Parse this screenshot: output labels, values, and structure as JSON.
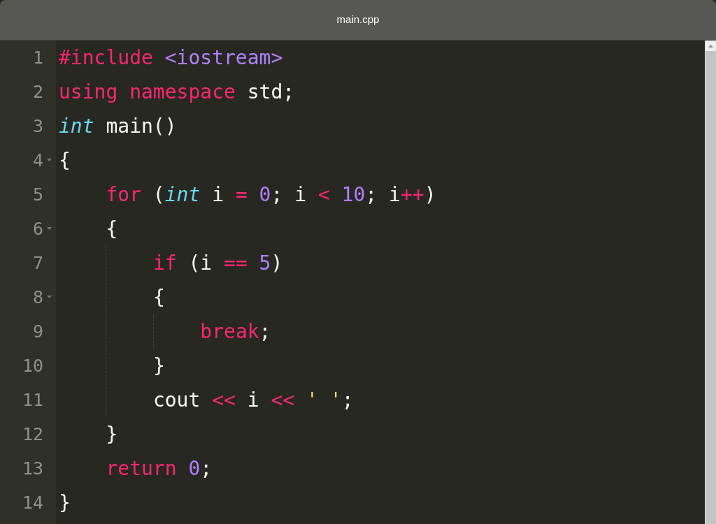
{
  "window": {
    "title": "main.cpp"
  },
  "lines": [
    {
      "number": "1",
      "foldable": false,
      "tokens": [
        {
          "kind": "preprocessor",
          "text": "#include"
        },
        {
          "kind": "header",
          "text": " <iostream>"
        }
      ]
    },
    {
      "number": "2",
      "foldable": false,
      "tokens": [
        {
          "kind": "keyword",
          "text": "using"
        },
        {
          "kind": "keyword",
          "text": " namespace"
        },
        {
          "kind": "plain",
          "text": " std;"
        }
      ]
    },
    {
      "number": "3",
      "foldable": false,
      "tokens": [
        {
          "kind": "type",
          "text": "int"
        },
        {
          "kind": "plain",
          "text": " main()"
        }
      ]
    },
    {
      "number": "4",
      "foldable": true,
      "tokens": [
        {
          "kind": "plain",
          "text": "{"
        }
      ],
      "children": [
        {
          "number": "5",
          "foldable": false,
          "tokens": [
            {
              "kind": "keyword",
              "text": "for"
            },
            {
              "kind": "plain",
              "text": " ("
            },
            {
              "kind": "type",
              "text": "int"
            },
            {
              "kind": "plain",
              "text": " i "
            },
            {
              "kind": "operator",
              "text": "="
            },
            {
              "kind": "number",
              "text": " 0"
            },
            {
              "kind": "plain",
              "text": "; i "
            },
            {
              "kind": "operator",
              "text": "<"
            },
            {
              "kind": "number",
              "text": " 10"
            },
            {
              "kind": "plain",
              "text": "; i"
            },
            {
              "kind": "operator",
              "text": "++"
            },
            {
              "kind": "plain",
              "text": ")"
            }
          ]
        },
        {
          "number": "6",
          "foldable": true,
          "tokens": [
            {
              "kind": "plain",
              "text": "{"
            }
          ],
          "children": [
            {
              "number": "7",
              "foldable": false,
              "tokens": [
                {
                  "kind": "keyword",
                  "text": "if"
                },
                {
                  "kind": "plain",
                  "text": " (i "
                },
                {
                  "kind": "operator",
                  "text": "=="
                },
                {
                  "kind": "number",
                  "text": " 5"
                },
                {
                  "kind": "plain",
                  "text": ")"
                }
              ]
            },
            {
              "number": "8",
              "foldable": true,
              "tokens": [
                {
                  "kind": "plain",
                  "text": "{"
                }
              ],
              "children": [
                {
                  "number": "9",
                  "foldable": false,
                  "tokens": [
                    {
                      "kind": "keyword",
                      "text": "break"
                    },
                    {
                      "kind": "plain",
                      "text": ";"
                    }
                  ]
                }
              ]
            },
            {
              "number": "10",
              "foldable": false,
              "tokens": [
                {
                  "kind": "plain",
                  "text": "}"
                }
              ]
            },
            {
              "number": "11",
              "foldable": false,
              "tokens": [
                {
                  "kind": "plain",
                  "text": "cout "
                },
                {
                  "kind": "operator",
                  "text": "<<"
                },
                {
                  "kind": "plain",
                  "text": " i "
                },
                {
                  "kind": "operator",
                  "text": "<<"
                },
                {
                  "kind": "string",
                  "text": " ' '"
                },
                {
                  "kind": "plain",
                  "text": ";"
                }
              ]
            }
          ]
        },
        {
          "number": "12",
          "foldable": false,
          "tokens": [
            {
              "kind": "plain",
              "text": "}"
            }
          ]
        },
        {
          "number": "13",
          "foldable": false,
          "tokens": [
            {
              "kind": "keyword",
              "text": "return"
            },
            {
              "kind": "number",
              "text": " 0"
            },
            {
              "kind": "plain",
              "text": ";"
            }
          ]
        }
      ]
    },
    {
      "number": "14",
      "foldable": false,
      "tokens": [
        {
          "kind": "plain",
          "text": "}"
        }
      ]
    }
  ]
}
